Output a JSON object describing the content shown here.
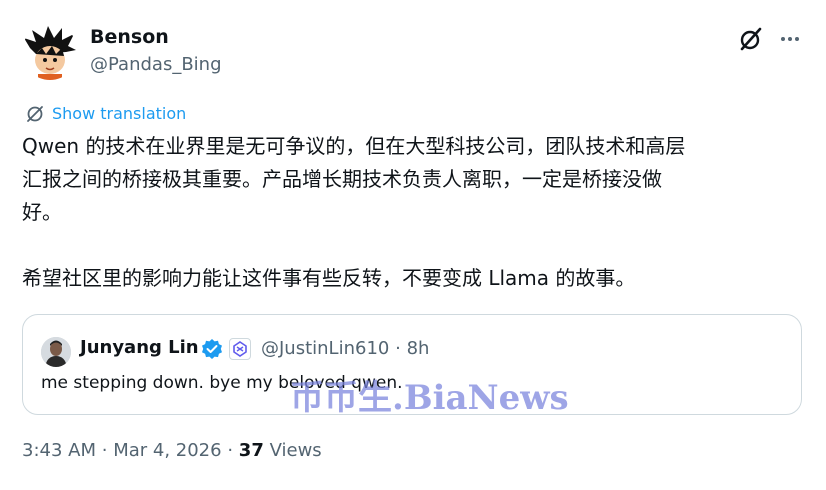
{
  "author": {
    "display_name": "Benson",
    "handle": "@Pandas_Bing"
  },
  "icons": {
    "grok": "grok-slash-icon",
    "more": "more-options-icon",
    "translate": "translate-icon",
    "verified": "verified-badge-icon",
    "affiliate": "qwen-affiliate-icon"
  },
  "translate_label": "Show translation",
  "body": {
    "line1": "Qwen 的技术在业界里是无可争议的，但在大型科技公司，团队技术和高层",
    "line2": "汇报之间的桥接极其重要。产品增长期技术负责人离职，一定是桥接没做",
    "line3": "好。",
    "line4": "希望社区里的影响力能让这件事有些反转，不要变成 Llama 的故事。"
  },
  "quote": {
    "display_name": "Junyang Lin",
    "handle": "@JustinLin610",
    "separator": "·",
    "time": "8h",
    "text": "me stepping down. bye my beloved qwen."
  },
  "watermark": "币币生.BiaNews",
  "footer": {
    "time": "3:43 AM",
    "separator": "·",
    "date": "Mar 4, 2026",
    "views_count": "37",
    "views_label": "Views"
  },
  "colors": {
    "accent": "#1d9bf0",
    "muted": "#536471",
    "text": "#0f1419",
    "border": "#cfd9de",
    "watermark": "#7882dc"
  }
}
